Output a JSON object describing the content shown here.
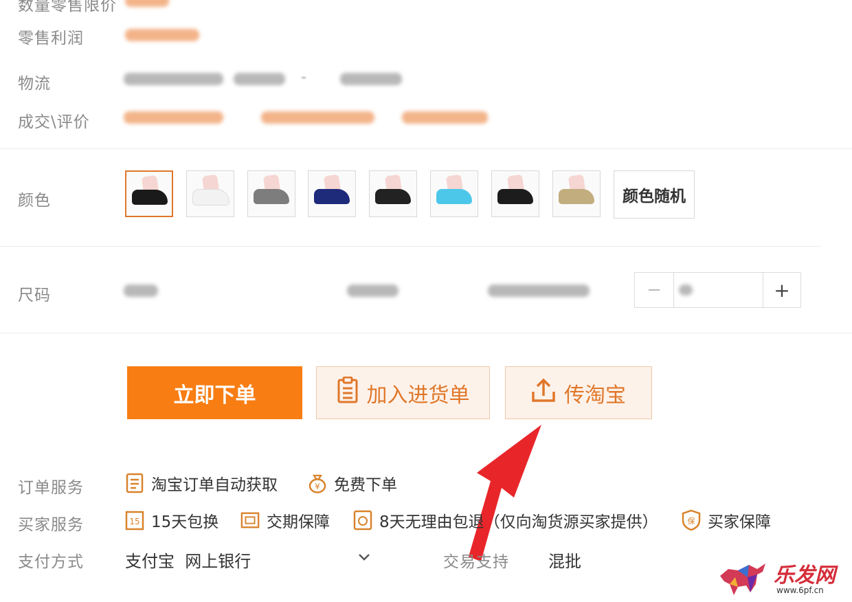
{
  "labels": {
    "price_top": "数量零售限价",
    "retail_profit": "零售利润",
    "logistics": "物流",
    "deals_reviews": "成交\\评价",
    "color": "颜色",
    "size": "尺码",
    "order_service": "订单服务",
    "buyer_service": "买家服务",
    "payment": "支付方式",
    "trade_support": "交易支持"
  },
  "logistics_suffix": "-",
  "colors": {
    "swatches": [
      {
        "name": "black",
        "sock": "#1a1a1a",
        "selected": true
      },
      {
        "name": "white",
        "sock": "#f2f2f2",
        "selected": false
      },
      {
        "name": "gray",
        "sock": "#7d7d7d",
        "selected": false
      },
      {
        "name": "navy",
        "sock": "#1e2a7a",
        "selected": false
      },
      {
        "name": "black-2",
        "sock": "#222222",
        "selected": false
      },
      {
        "name": "sky-blue",
        "sock": "#4cc7ea",
        "selected": false
      },
      {
        "name": "black-3",
        "sock": "#1c1c1c",
        "selected": false
      },
      {
        "name": "khaki",
        "sock": "#c2ad7e",
        "selected": false
      }
    ],
    "random_label": "颜色随机"
  },
  "stepper": {
    "minus": "−",
    "plus": "+"
  },
  "buttons": {
    "order_now": "立即下单",
    "add_purchase_list": "加入进货单",
    "upload_taobao": "传淘宝"
  },
  "order_services": [
    {
      "icon": "document-icon",
      "label": "淘宝订单自动获取"
    },
    {
      "icon": "money-bag-icon",
      "label": "免费下单"
    }
  ],
  "buyer_services": [
    {
      "icon": "calendar-15-icon",
      "label": "15天包换"
    },
    {
      "icon": "delivery-icon",
      "label": "交期保障"
    },
    {
      "icon": "return-icon",
      "label": "8天无理由包退（仅向淘货源买家提供）"
    },
    {
      "icon": "shield-guarantee-icon",
      "label": "买家保障"
    }
  ],
  "payment": {
    "methods": "支付宝  网上银行",
    "trade_support_value": "混批"
  },
  "watermark": {
    "text": "乐发网",
    "url": "www.6pf.cn"
  },
  "accent": "#f87d12"
}
